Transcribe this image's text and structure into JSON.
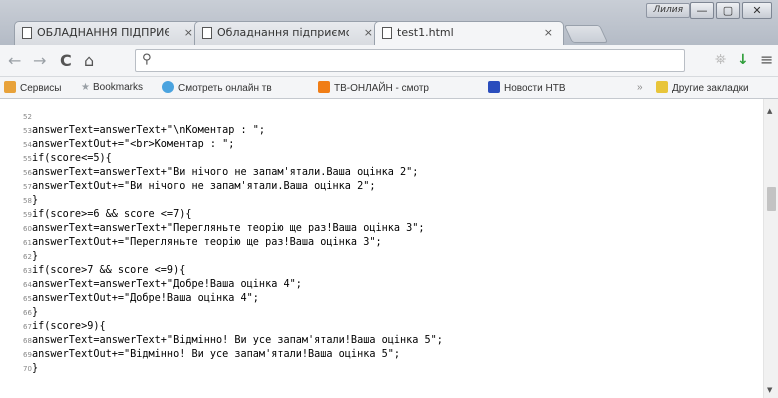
{
  "window": {
    "user_label": "Лилия",
    "minimize": "—",
    "maximize": "▢",
    "close": "✕"
  },
  "tabs": [
    {
      "title": "ОБЛАДНАННЯ ПІДПРИЄ",
      "close": "×",
      "active": false
    },
    {
      "title": "Обладнання підприємст",
      "close": "×",
      "active": false
    },
    {
      "title": "test1.html",
      "close": "×",
      "active": true
    }
  ],
  "toolbar": {
    "back": "←",
    "forward": "→",
    "reload": "C",
    "home": "⌂",
    "search_icon": "search-icon",
    "address_value": "",
    "menu": "≡"
  },
  "bookmarks": [
    {
      "label": "Сервисы",
      "icon": "apps-icon",
      "color": "#e8a23a"
    },
    {
      "label": "Bookmarks",
      "icon": "star-icon",
      "color": "#9aa0a6"
    },
    {
      "label": "Смотреть онлайн тв",
      "icon": "tv-icon",
      "color": "#4aa3df"
    },
    {
      "label": "ТВ-ОНЛАЙН - смотр",
      "icon": "ok-icon",
      "color": "#f07d16"
    },
    {
      "label": "Новости НТВ",
      "icon": "ntv-icon",
      "color": "#2a4dbd"
    },
    {
      "label": "»",
      "icon": "",
      "color": ""
    },
    {
      "label": "Другие закладки",
      "icon": "folder-icon",
      "color": "#e8c53a"
    }
  ],
  "code_lines": [
    {
      "n": "52",
      "text": ""
    },
    {
      "n": "53",
      "text": "answerText=answerText+\"\\nКоментар : \";"
    },
    {
      "n": "54",
      "text": "answerTextOut+=\"<br>Коментар : \";"
    },
    {
      "n": "55",
      "text": "if(score<=5){"
    },
    {
      "n": "56",
      "text": "answerText=answerText+\"Ви нічого не запам'ятали.Ваша оцінка 2\";"
    },
    {
      "n": "57",
      "text": "answerTextOut+=\"Ви нічого не запам'ятали.Ваша оцінка 2\";"
    },
    {
      "n": "58",
      "text": "}"
    },
    {
      "n": "59",
      "text": "if(score>=6 && score <=7){"
    },
    {
      "n": "60",
      "text": "answerText=answerText+\"Перегляньте теорію ще раз!Ваша оцінка 3\";"
    },
    {
      "n": "61",
      "text": "answerTextOut+=\"Перегляньте теорію ще раз!Ваша оцінка 3\";"
    },
    {
      "n": "62",
      "text": "}"
    },
    {
      "n": "63",
      "text": "if(score>7 && score <=9){"
    },
    {
      "n": "64",
      "text": "answerText=answerText+\"Добре!Ваша оцінка 4\";"
    },
    {
      "n": "65",
      "text": "answerTextOut+=\"Добре!Ваша оцінка 4\";"
    },
    {
      "n": "66",
      "text": "}"
    },
    {
      "n": "67",
      "text": "if(score>9){"
    },
    {
      "n": "68",
      "text": "answerText=answerText+\"Відмінно! Ви усе запам'ятали!Ваша оцінка 5\";"
    },
    {
      "n": "69",
      "text": "answerTextOut+=\"Відмінно! Ви усе запам'ятали!Ваша оцінка 5\";"
    },
    {
      "n": "70",
      "text": "}"
    }
  ]
}
